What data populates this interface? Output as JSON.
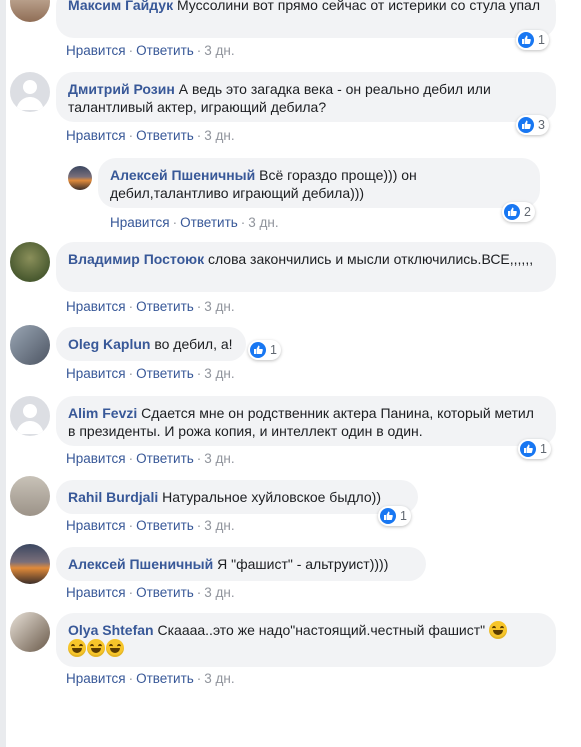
{
  "comments": [
    {
      "author": "Максим Гайдук",
      "text": "Муссолини вот прямо сейчас от истерики со стула упал",
      "like_label": "Нравится",
      "reply_label": "Ответить",
      "time": "3 дн.",
      "reactions": "1"
    },
    {
      "author": "Дмитрий Розин",
      "text": "А ведь это загадка века - он реально дебил или талантливый актер, играющий дебила?",
      "like_label": "Нравится",
      "reply_label": "Ответить",
      "time": "3 дн.",
      "reactions": "3"
    },
    {
      "author": "Алексей Пшеничный",
      "text": "Всё гораздо проще))) он дебил,талантливо играющий дебила)))",
      "like_label": "Нравится",
      "reply_label": "Ответить",
      "time": "3 дн.",
      "reactions": "2"
    },
    {
      "author": "Владимир Постоюк",
      "text": "слова закончились и мысли отключились.ВСЕ,,,,,,",
      "like_label": "Нравится",
      "reply_label": "Ответить",
      "time": "3 дн."
    },
    {
      "author": "Oleg Kaplun",
      "text": "во дебил, а!",
      "like_label": "Нравится",
      "reply_label": "Ответить",
      "time": "3 дн.",
      "reactions": "1"
    },
    {
      "author": "Alim Fevzi",
      "text": "Сдается мне он родственник актера Панина, который метил в президенты. И рожа копия, и интеллект один в один.",
      "like_label": "Нравится",
      "reply_label": "Ответить",
      "time": "3 дн.",
      "reactions": "1"
    },
    {
      "author": "Rahil Burdjali",
      "text": "Натуральное хуйловское быдло))",
      "like_label": "Нравится",
      "reply_label": "Ответить",
      "time": "3 дн.",
      "reactions": "1"
    },
    {
      "author": "Алексей Пшеничный",
      "text": "Я \"фашист\" - альтруист))))",
      "like_label": "Нравится",
      "reply_label": "Ответить",
      "time": "3 дн."
    },
    {
      "author": "Olya Shtefan",
      "text": "Скаааа..это же надо\"настоящий.честный фашист\"",
      "like_label": "Нравится",
      "reply_label": "Ответить",
      "time": "3 дн."
    }
  ],
  "colors": {
    "author": "#385898",
    "bubble": "#f2f3f5",
    "muted": "#90949c",
    "like": "#1877f2"
  },
  "icons": {
    "like": "thumbs-up-icon",
    "emoji": "grinning-face-icon"
  }
}
